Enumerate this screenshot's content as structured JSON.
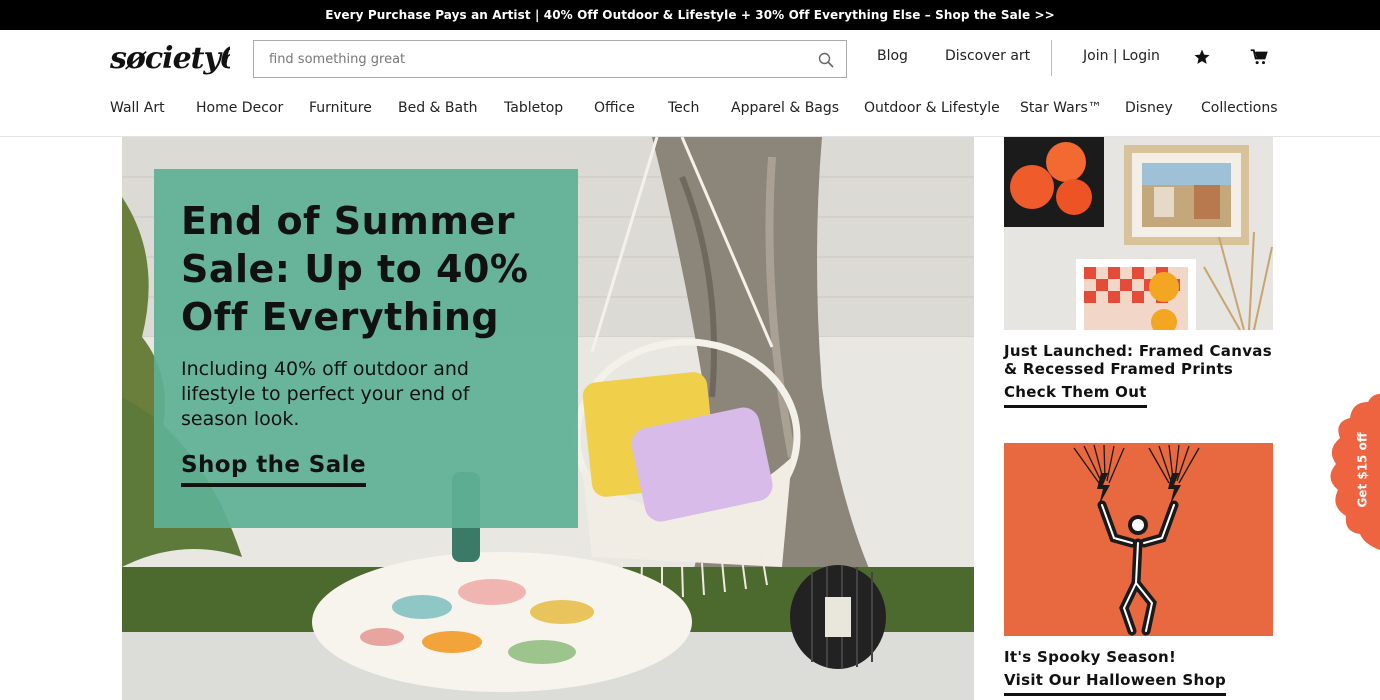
{
  "promo": {
    "text": "Every Purchase Pays an Artist | 40% Off Outdoor & Lifestyle + 30% Off Everything Else – Shop the Sale >>"
  },
  "brand": {
    "logo_text": "søciety6"
  },
  "search": {
    "placeholder": "find something great",
    "value": "",
    "icon": "search-icon"
  },
  "header": {
    "blog": "Blog",
    "discover": "Discover art",
    "account": "Join | Login",
    "icons": [
      "star-icon",
      "cart-icon"
    ]
  },
  "nav": {
    "items": [
      "Wall Art",
      "Home Decor",
      "Furniture",
      "Bed & Bath",
      "Tabletop",
      "Office",
      "Tech",
      "Apparel & Bags",
      "Outdoor & Lifestyle",
      "Star Wars™",
      "Disney",
      "Collections"
    ]
  },
  "hero": {
    "title": "End of Summer Sale: Up to 40% Off Everything",
    "subtitle": "Including 40% off outdoor and lifestyle to perfect your end of season look.",
    "cta": "Shop the Sale",
    "panel_color": "#5fb096"
  },
  "cards": [
    {
      "title": "Just Launched: Framed Canvas & Recessed Framed Prints",
      "cta": "Check Them Out"
    },
    {
      "title": "It's Spooky Season!",
      "cta": "Visit Our Halloween Shop",
      "bg_color": "#e8683f"
    }
  ],
  "coupon": {
    "text": "Get $15 off",
    "color": "#ee6340"
  }
}
